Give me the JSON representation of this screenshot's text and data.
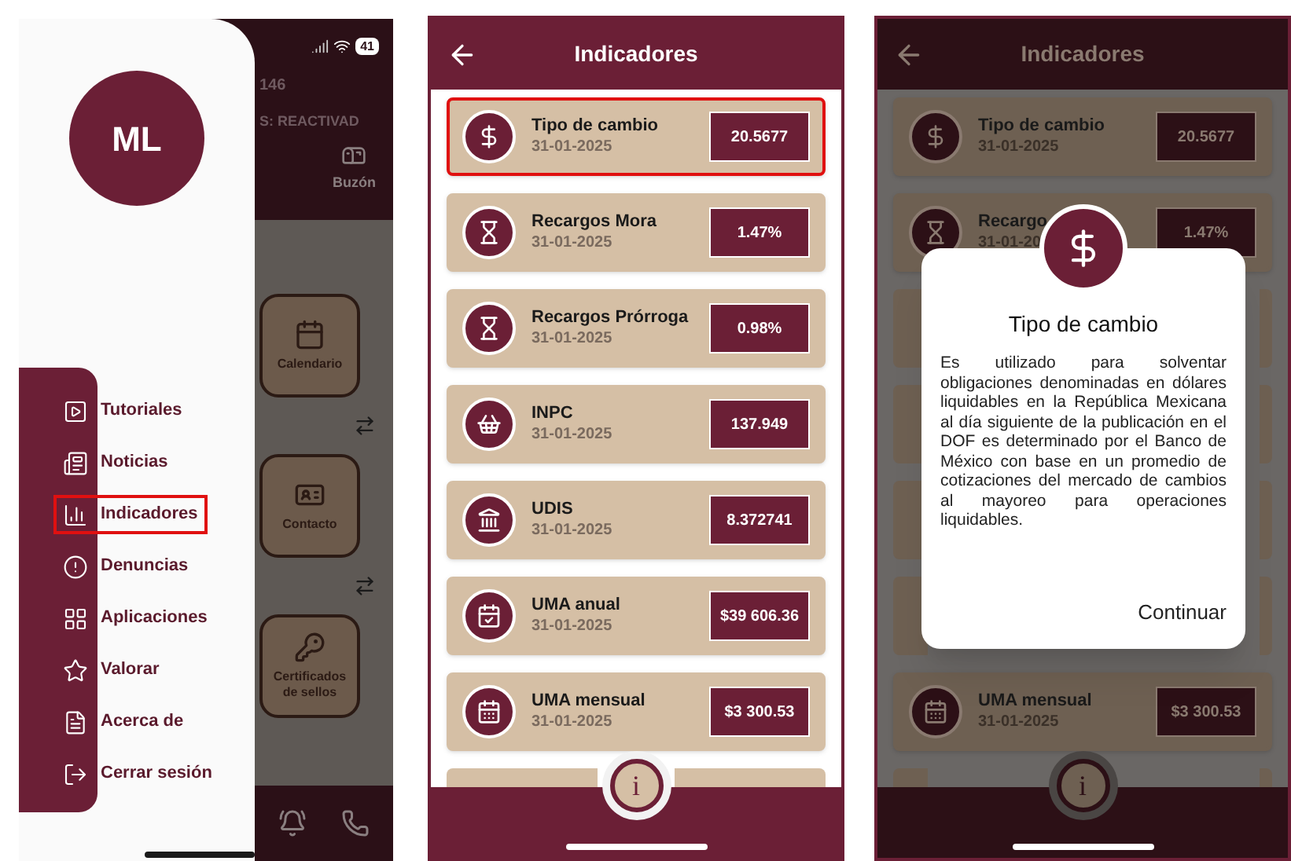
{
  "menu_screen": {
    "status_bar": {
      "battery": "41"
    },
    "avatar_initials": "ML",
    "background": {
      "account_fragment": "146",
      "status_fragment": "S: REACTIVAD",
      "header_tab": "Buzón",
      "tiles": [
        "Calendario",
        "Contacto",
        "Certificados de sellos"
      ]
    },
    "menu": [
      {
        "label": "Tutoriales",
        "selected": false
      },
      {
        "label": "Noticias",
        "selected": false
      },
      {
        "label": "Indicadores",
        "selected": true
      },
      {
        "label": "Denuncias",
        "selected": false
      },
      {
        "label": "Aplicaciones",
        "selected": false
      },
      {
        "label": "Valorar",
        "selected": false
      },
      {
        "label": "Acerca de",
        "selected": false
      },
      {
        "label": "Cerrar sesión",
        "selected": false
      }
    ]
  },
  "indicators_screen": {
    "title": "Indicadores",
    "info_button": "i",
    "items": [
      {
        "kind": "row",
        "name": "Tipo de cambio",
        "date": "31-01-2025",
        "value": "20.5677",
        "selected": true
      },
      {
        "kind": "row",
        "name": "Recargos Mora",
        "date": "31-01-2025",
        "value": "1.47%",
        "selected": false
      },
      {
        "kind": "row",
        "name": "Recargos Prórroga",
        "date": "31-01-2025",
        "value": "0.98%",
        "selected": false
      },
      {
        "kind": "row",
        "name": "INPC",
        "date": "31-01-2025",
        "value": "137.949",
        "selected": false
      },
      {
        "kind": "row",
        "name": "UDIS",
        "date": "31-01-2025",
        "value": "8.372741",
        "selected": false
      },
      {
        "kind": "row",
        "name": "UMA anual",
        "date": "31-01-2025",
        "value": "$39 606.36",
        "selected": false
      },
      {
        "kind": "row",
        "name": "UMA mensual",
        "date": "31-01-2025",
        "value": "$3 300.53",
        "selected": false
      },
      {
        "kind": "covered"
      }
    ]
  },
  "dialog_screen": {
    "title": "Indicadores",
    "info_button": "i",
    "items": [
      {
        "kind": "row",
        "name": "Tipo de cambio",
        "date": "31-01-2025",
        "value": "20.5677"
      },
      {
        "kind": "row",
        "name": "Recargo",
        "date": "31-01-20",
        "value": "1.47%"
      },
      {
        "kind": "covered"
      },
      {
        "kind": "covered"
      },
      {
        "kind": "covered"
      },
      {
        "kind": "covered"
      },
      {
        "kind": "row",
        "name": "UMA mensual",
        "date": "31-01-2025",
        "value": "$3 300.53"
      },
      {
        "kind": "covered"
      }
    ],
    "dialog": {
      "title": "Tipo de cambio",
      "body": "Es utilizado para solventar obligaciones denominadas en dólares liquidables en la República Mexicana al día siguiente de la publicación en el DOF es determinado por el Banco de México con base en un promedio de cotizaciones del mercado de cambios al mayoreo para operaciones liquidables.",
      "button": "Continuar"
    }
  }
}
